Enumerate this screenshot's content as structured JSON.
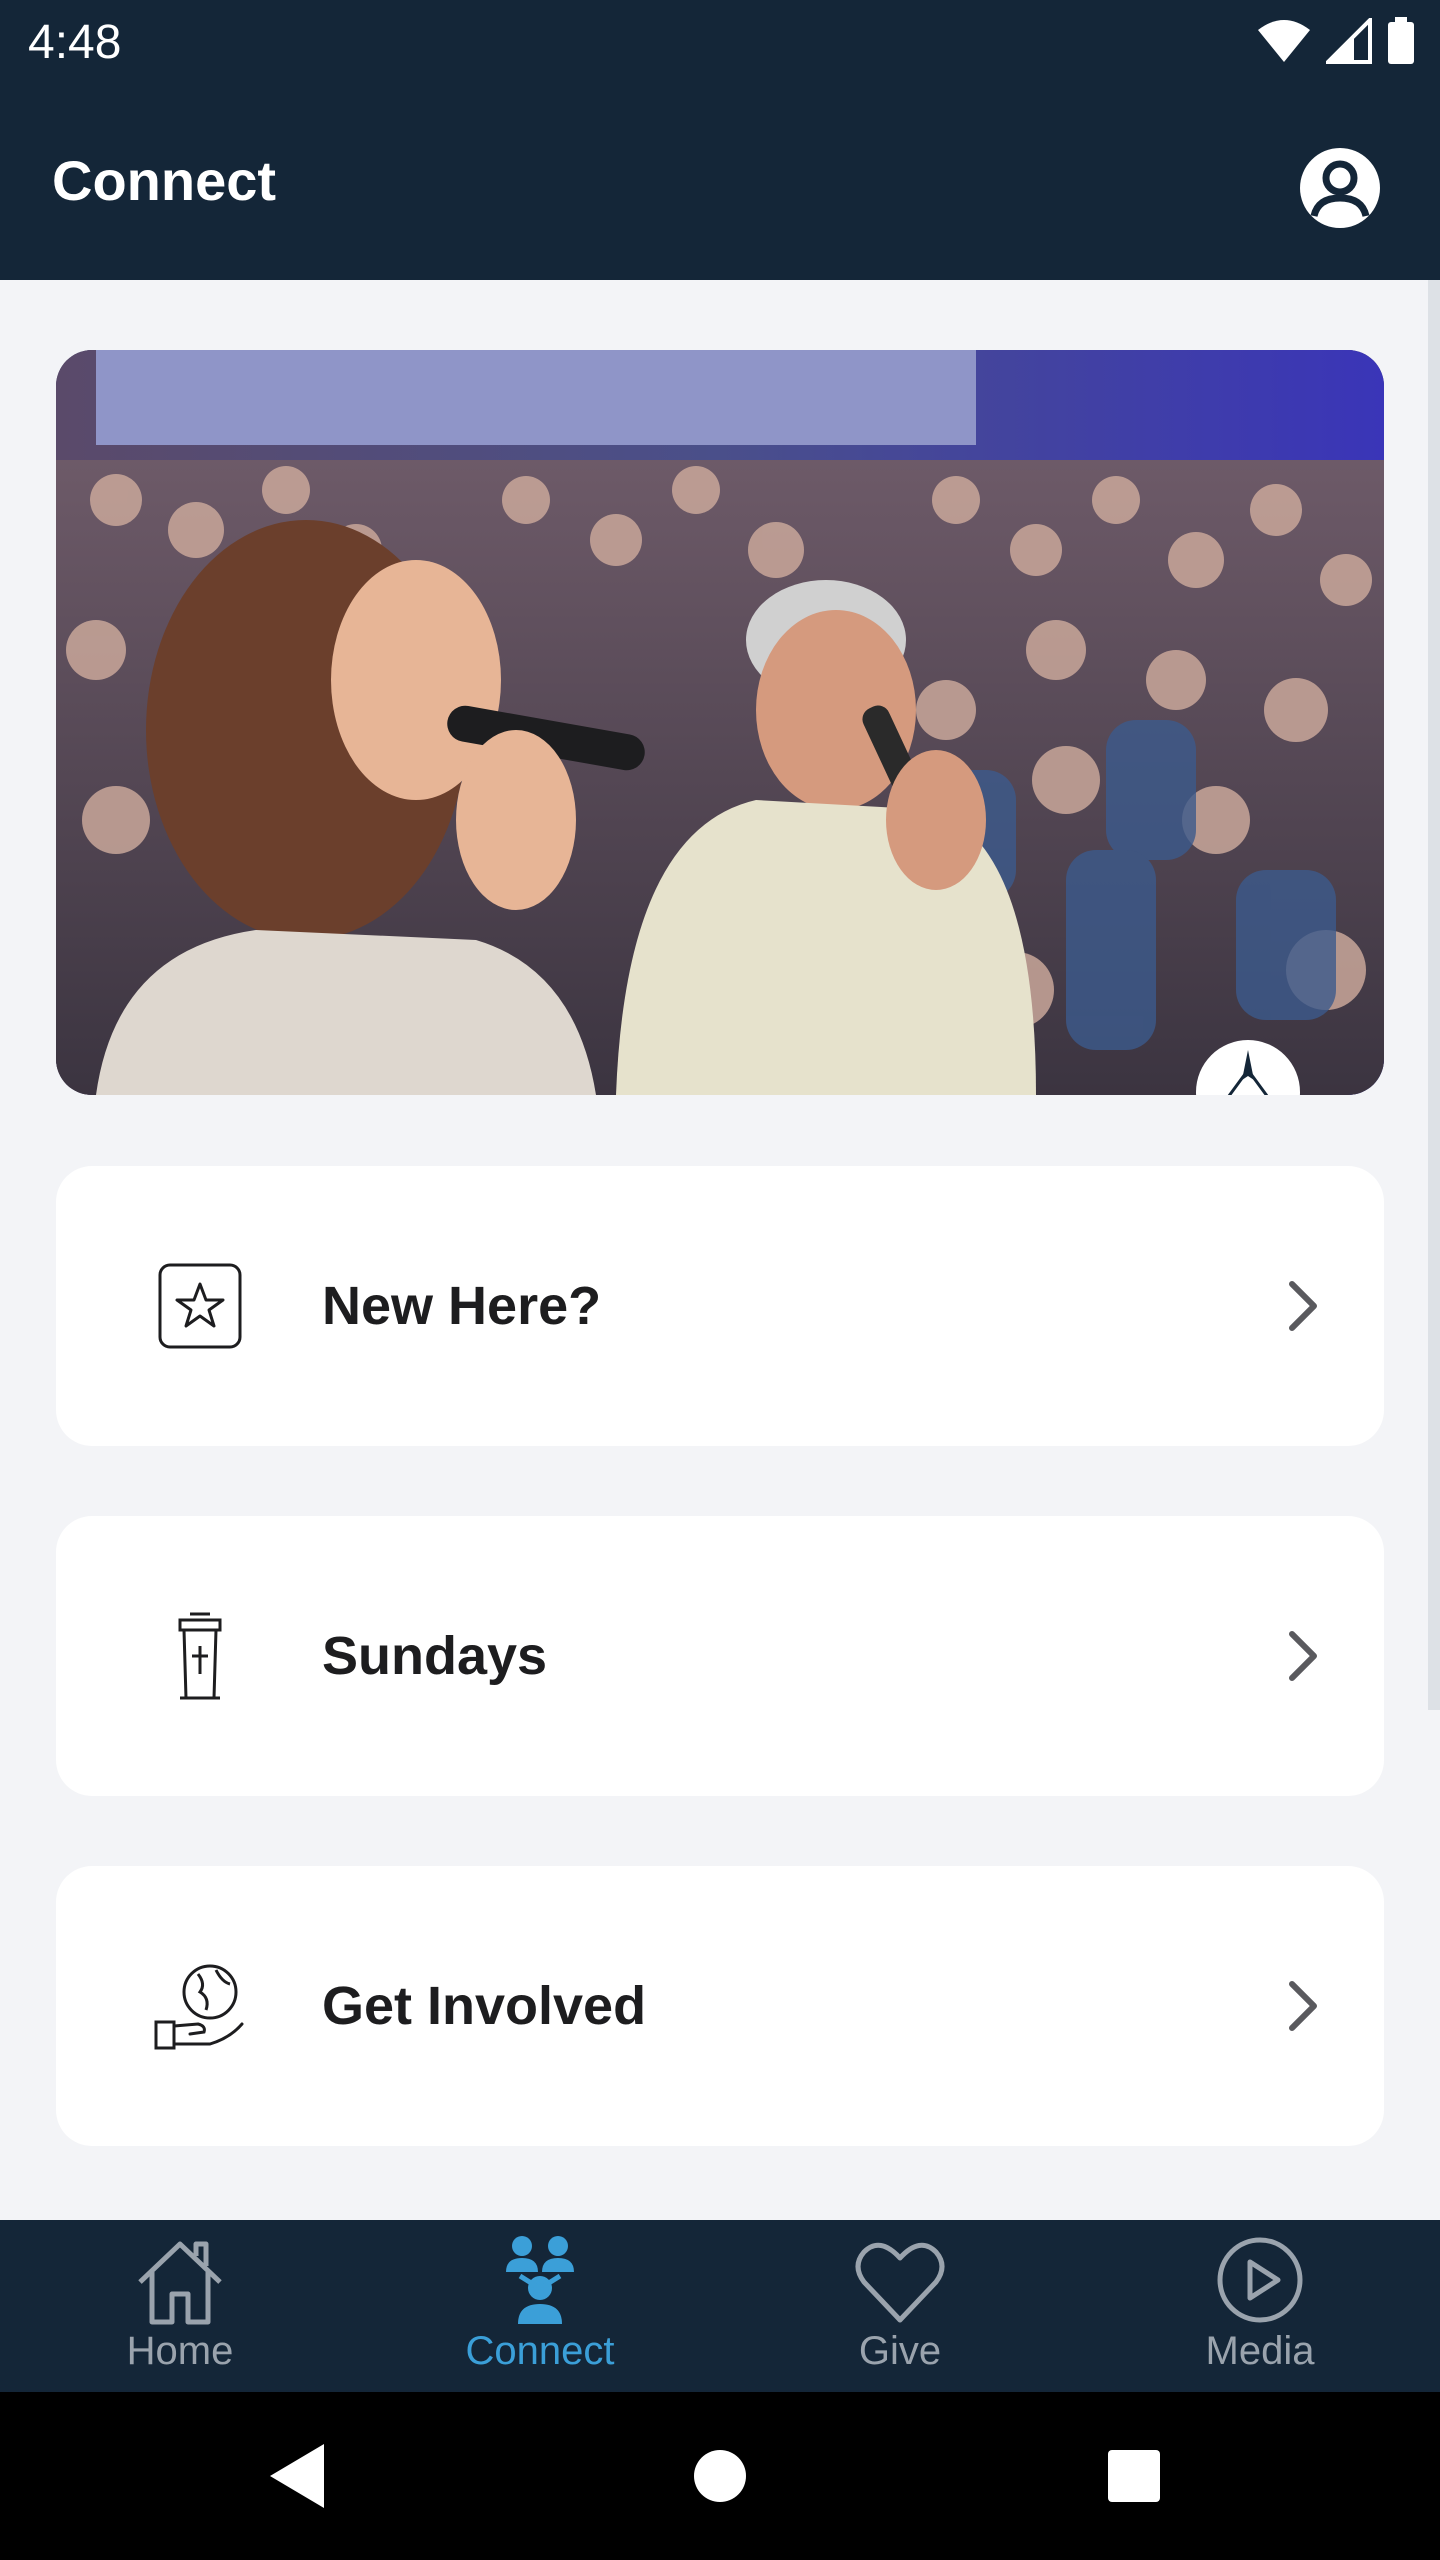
{
  "status_bar": {
    "time": "4:48",
    "icons": [
      "wifi-icon",
      "signal-icon",
      "battery-icon"
    ]
  },
  "header": {
    "title": "Connect",
    "profile_icon": "profile-icon"
  },
  "hero": {
    "description_icon": "church-logo-badge"
  },
  "cards": [
    {
      "label": "New Here?",
      "icon": "star-icon"
    },
    {
      "label": "Sundays",
      "icon": "pulpit-icon"
    },
    {
      "label": "Get Involved",
      "icon": "globe-hand-icon"
    }
  ],
  "tabs": [
    {
      "label": "Home",
      "icon": "home-icon",
      "active": false
    },
    {
      "label": "Connect",
      "icon": "people-icon",
      "active": true
    },
    {
      "label": "Give",
      "icon": "heart-icon",
      "active": false
    },
    {
      "label": "Media",
      "icon": "play-icon",
      "active": false
    }
  ],
  "colors": {
    "header_bg": "#142638",
    "active_tab": "#3b9fd8",
    "inactive_tab": "#9aa3ad",
    "page_bg": "#f3f4f7"
  },
  "nav_bar": {
    "buttons": [
      "back",
      "home",
      "recents"
    ]
  }
}
